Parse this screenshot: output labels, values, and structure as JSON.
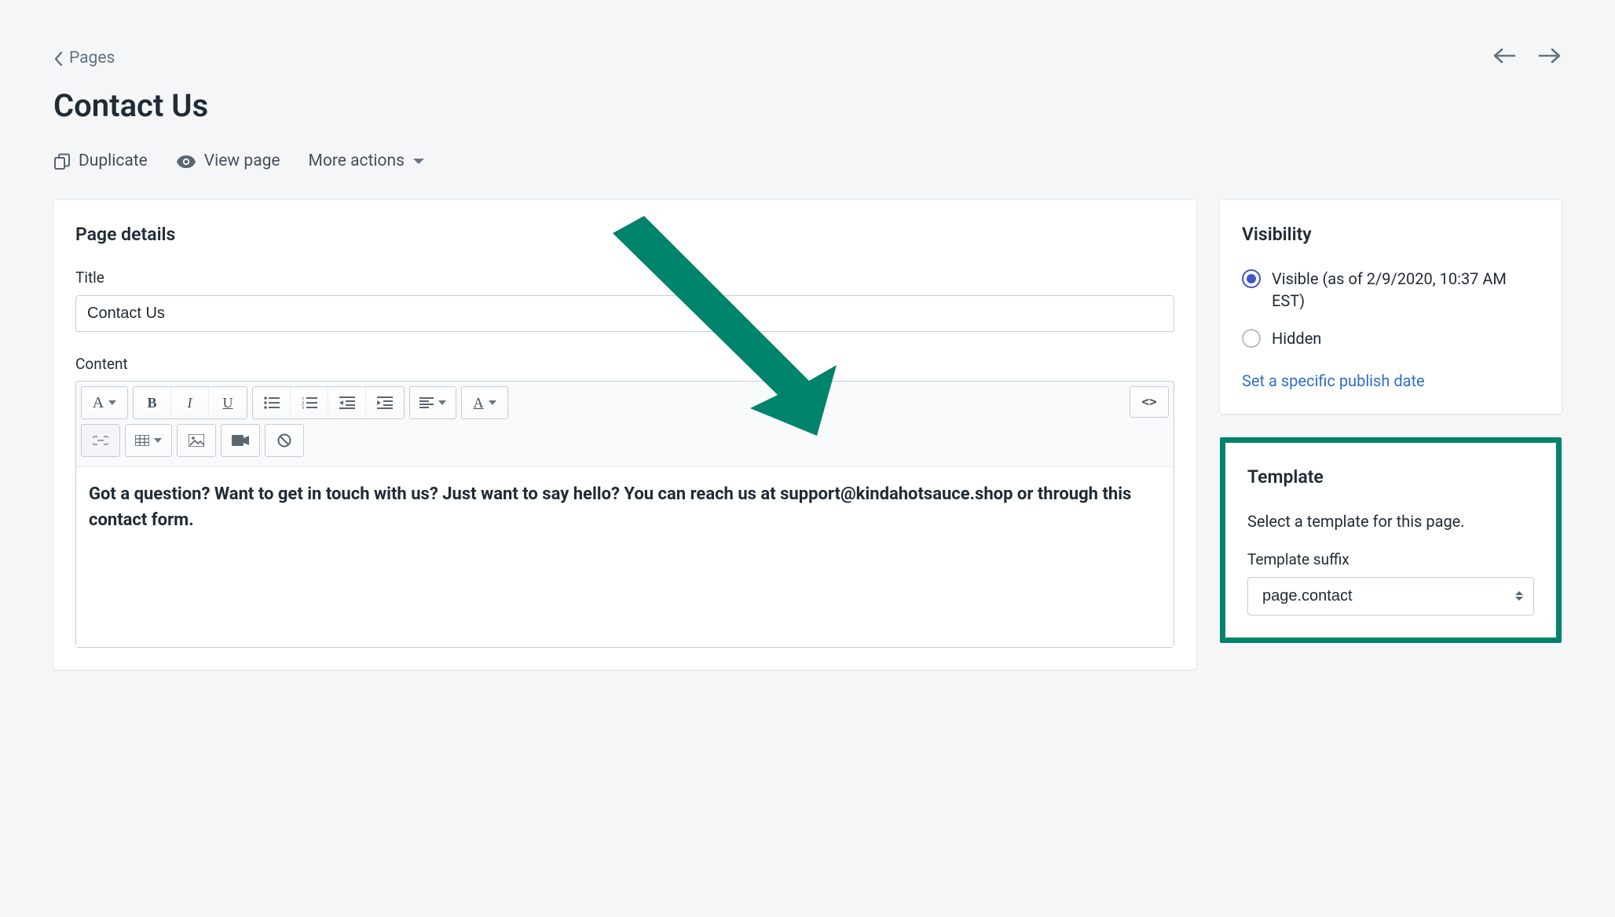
{
  "breadcrumb": {
    "label": "Pages"
  },
  "page_title": "Contact Us",
  "actions": {
    "duplicate": "Duplicate",
    "view_page": "View page",
    "more_actions": "More actions"
  },
  "main": {
    "details_heading": "Page details",
    "title_label": "Title",
    "title_value": "Contact Us",
    "content_label": "Content",
    "content_body": "Got a question? Want to get in touch with us? Just want to say hello? You can reach us at support@kindahotsauce.shop or through this contact form.",
    "code_toggle": "<>"
  },
  "visibility": {
    "heading": "Visibility",
    "visible_label": "Visible (as of 2/9/2020, 10:37 AM EST)",
    "hidden_label": "Hidden",
    "set_date_link": "Set a specific publish date"
  },
  "template": {
    "heading": "Template",
    "helper": "Select a template for this page.",
    "suffix_label": "Template suffix",
    "suffix_value": "page.contact"
  },
  "annotation": {
    "color": "#00836b"
  }
}
